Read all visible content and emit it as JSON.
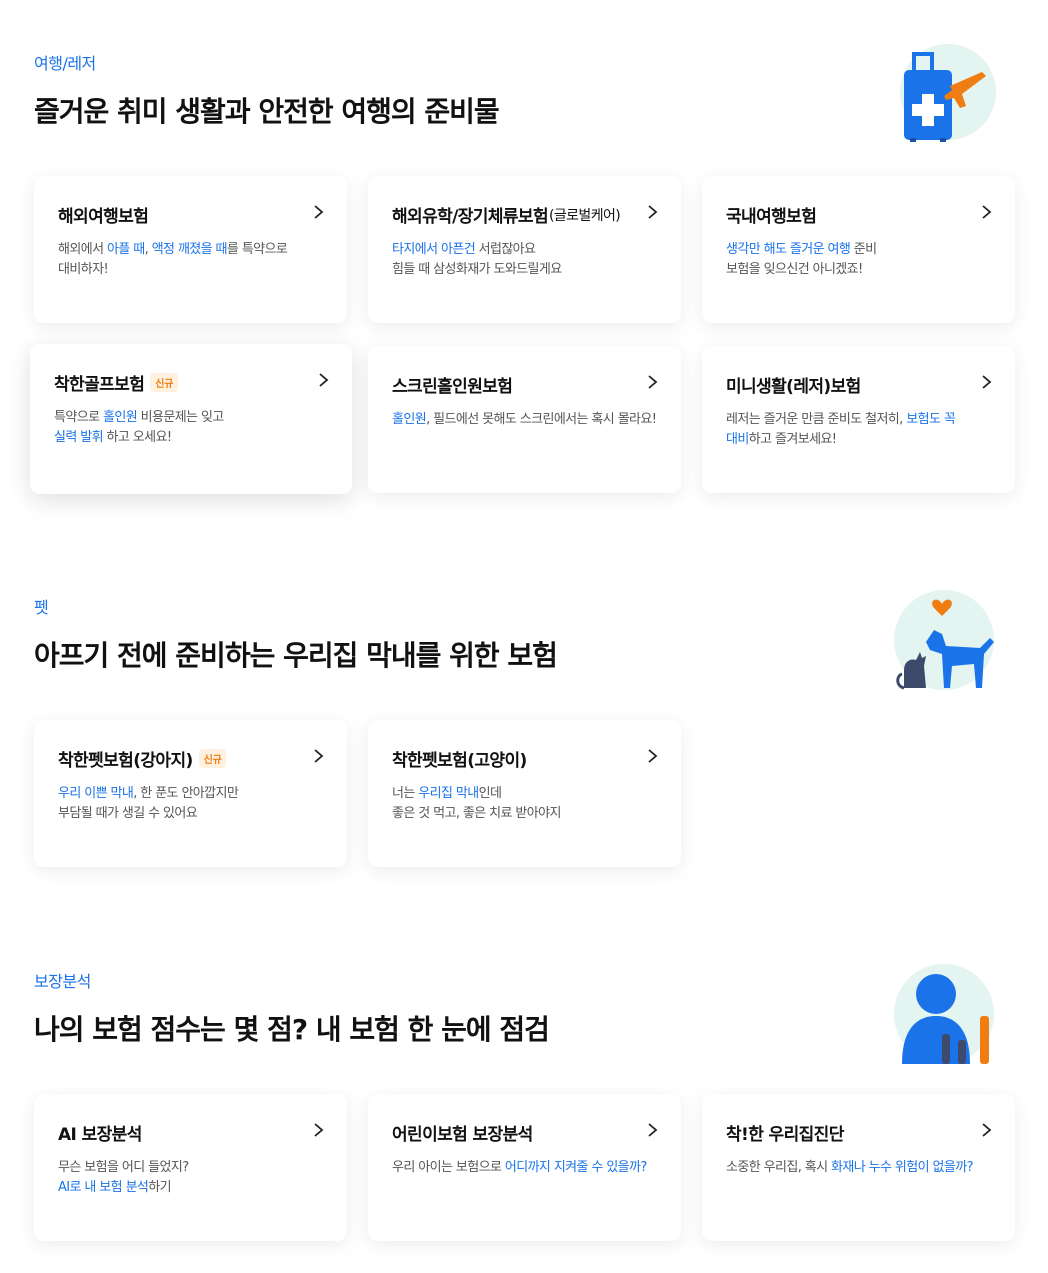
{
  "sections": [
    {
      "tag": "여행/레저",
      "title": "즐거운 취미 생활과 안전한 여행의 준비물",
      "icon": "luggage-airplane-icon",
      "cards": [
        {
          "title": "해외여행보험",
          "desc": [
            [
              [
                "해외에서 ",
                false
              ],
              [
                "아플 때",
                true
              ],
              [
                ", ",
                false
              ],
              [
                "액정 깨졌을 때",
                true
              ],
              [
                "를 특약으로",
                false
              ]
            ],
            [
              [
                "대비하자!",
                false
              ]
            ]
          ]
        },
        {
          "title": "해외유학/장기체류보험",
          "sub": "(글로벌케어)",
          "desc": [
            [
              [
                "타지에서 아픈건",
                true
              ],
              [
                " 서럽잖아요",
                false
              ]
            ],
            [
              [
                "힘들 때 삼성화재가 도와드릴게요",
                false
              ]
            ]
          ]
        },
        {
          "title": "국내여행보험",
          "desc": [
            [
              [
                "생각만 해도 즐거운 여행",
                true
              ],
              [
                " 준비",
                false
              ]
            ],
            [
              [
                "보험을 잊으신건 아니겠죠!",
                false
              ]
            ]
          ]
        },
        {
          "title": "착한골프보험",
          "badge": "신규",
          "desc": [
            [
              [
                "특약으로 ",
                false
              ],
              [
                "홀인원",
                true
              ],
              [
                " 비용문제는 잊고",
                false
              ]
            ],
            [
              [
                "실력 발휘",
                true
              ],
              [
                " 하고 오세요!",
                false
              ]
            ]
          ]
        },
        {
          "title": "스크린홀인원보험",
          "desc": [
            [
              [
                "홀인원",
                true
              ],
              [
                ", 필드에선 못해도 스크린에서는 혹시 몰라요!",
                false
              ]
            ]
          ]
        },
        {
          "title": "미니생활(레저)보험",
          "desc": [
            [
              [
                "레저는 즐거운 만큼 준비도 철저히, ",
                false
              ],
              [
                "보험도 꼭",
                true
              ]
            ],
            [
              [
                "대비",
                true
              ],
              [
                "하고 즐겨보세요!",
                false
              ]
            ]
          ]
        }
      ]
    },
    {
      "tag": "펫",
      "title": "아프기 전에 준비하는 우리집 막내를 위한 보험",
      "icon": "dog-cat-heart-icon",
      "cards": [
        {
          "title": "착한펫보험(강아지)",
          "badge": "신규",
          "desc": [
            [
              [
                "우리 이쁜 막내",
                true
              ],
              [
                ", 한 푼도 안아깝지만",
                false
              ]
            ],
            [
              [
                "부담될 때가 생길 수 있어요",
                false
              ]
            ]
          ]
        },
        {
          "title": "착한펫보험(고양이)",
          "desc": [
            [
              [
                "너는 ",
                false
              ],
              [
                "우리집 막내",
                true
              ],
              [
                "인데",
                false
              ]
            ],
            [
              [
                "좋은 것 먹고, 좋은 치료 받아야지",
                false
              ]
            ]
          ]
        }
      ]
    },
    {
      "tag": "보장분석",
      "title": "나의 보험 점수는 몇 점? 내 보험 한 눈에 점검",
      "icon": "person-bar-chart-icon",
      "cards": [
        {
          "title": "AI 보장분석",
          "desc": [
            [
              [
                "무슨 보험을 어디 들었지?",
                false
              ]
            ],
            [
              [
                "AI로 내 보험 분석",
                true
              ],
              [
                "하기",
                false
              ]
            ]
          ]
        },
        {
          "title": "어린이보험 보장분석",
          "desc": [
            [
              [
                "우리 아이는 보험으로 ",
                false
              ],
              [
                "어디까지 지켜줄 수 있을까?",
                true
              ]
            ]
          ]
        },
        {
          "title": "착!한 우리집진단",
          "desc": [
            [
              [
                "소중한 우리집, 혹시 ",
                false
              ],
              [
                "화재나 누수 위험이 없을까?",
                true
              ]
            ]
          ]
        }
      ]
    }
  ],
  "colors": {
    "accent": "#1a73e8",
    "badge": "#f07d12",
    "illustration_orange": "#f07d12",
    "illustration_bg": "#e3f4f1"
  }
}
